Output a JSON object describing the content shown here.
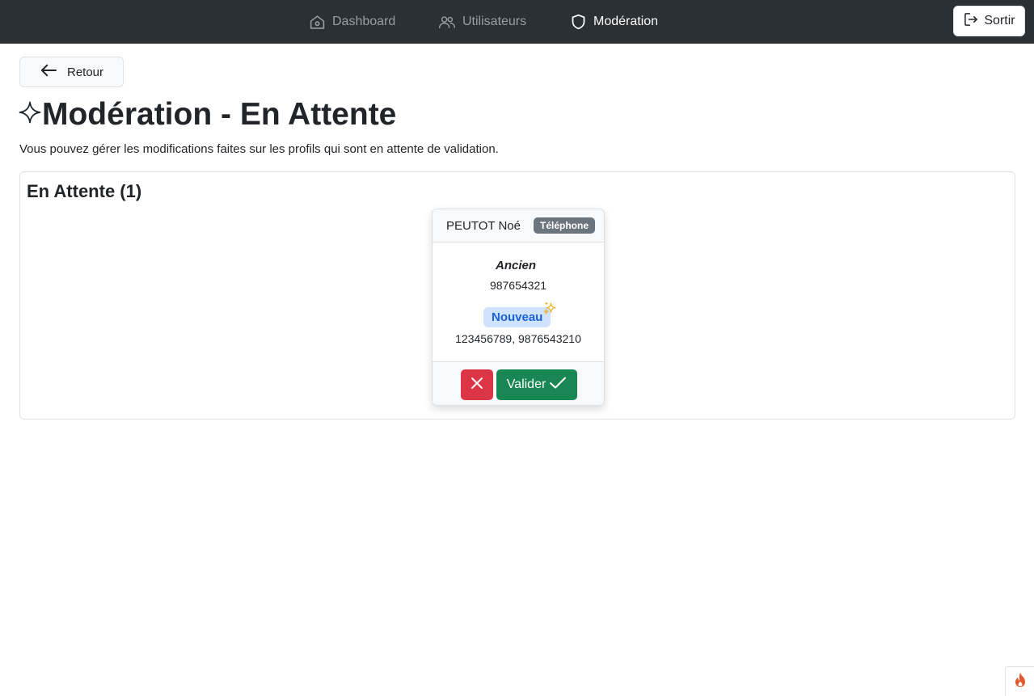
{
  "nav": {
    "dashboard_label": "Dashboard",
    "users_label": "Utilisateurs",
    "moderation_label": "Modération",
    "logout_label": "Sortir"
  },
  "back_label": "Retour",
  "page": {
    "title": "Modération - En Attente",
    "description": "Vous pouvez gérer les modifications faites sur les profils qui sont en attente de validation."
  },
  "pending": {
    "heading": "En Attente (1)",
    "cards": [
      {
        "name": "PEUTOT Noé",
        "badge": "Téléphone",
        "old_label": "Ancien",
        "old_value": "987654321",
        "new_label": "Nouveau",
        "new_value": "123456789, 9876543210",
        "validate_label": "Valider"
      }
    ]
  },
  "colors": {
    "navbar": "#2b3035",
    "danger": "#dc3545",
    "success": "#198754",
    "badge_secondary": "#6c757d",
    "new_label_bg": "#cfe2ff",
    "new_label_text": "#1a62d6",
    "sparkle": "#f0b429"
  },
  "icons": {
    "dashboard": "house-icon",
    "users": "people-icon",
    "moderation": "shield-icon",
    "logout": "logout-icon",
    "back": "arrow-left-icon",
    "title": "sparkle-outline-icon",
    "new": "sparkles-icon",
    "reject": "x-icon",
    "validate": "check-icon",
    "corner": "flame-icon"
  }
}
